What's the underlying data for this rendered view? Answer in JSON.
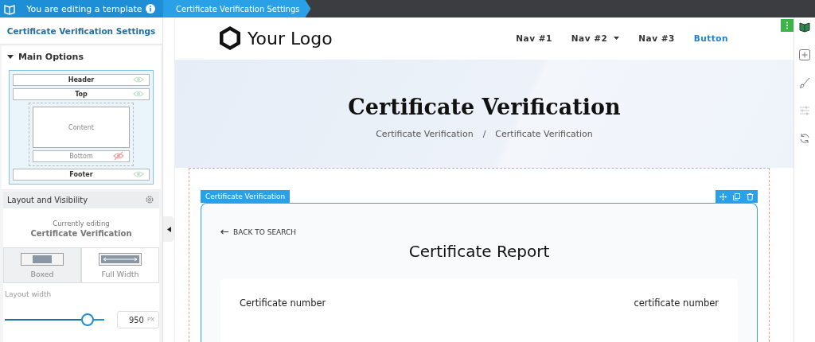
{
  "top_bar": {
    "notice": "You are editing a template",
    "breadcrumb": "Certificate Verification Settings"
  },
  "sidebar": {
    "title": "Certificate Verification Settings",
    "section": {
      "label": "Main Options",
      "expanded": true
    },
    "layout_diagram": [
      {
        "kind": "bar",
        "label": "Header",
        "visible": true
      },
      {
        "kind": "bar",
        "label": "Top",
        "visible": true
      },
      {
        "kind": "content",
        "label": "Content"
      },
      {
        "kind": "inner",
        "label": "Bottom",
        "visible": false
      },
      {
        "kind": "bar",
        "label": "Footer",
        "visible": true
      }
    ],
    "layout_visibility": "Layout and Visibility",
    "currently_editing": {
      "caption": "Currently editing",
      "name": "Certificate Verification"
    },
    "layout_options": [
      {
        "kind": "boxed",
        "label": "Boxed",
        "selected": true
      },
      {
        "kind": "full",
        "label": "Full Width",
        "selected": false
      }
    ],
    "layout_width": {
      "label": "Layout width",
      "level": 0.82,
      "value": "950",
      "unit": "PX"
    }
  },
  "page": {
    "logo": "Your Logo",
    "nav": [
      {
        "label": "Nav #1",
        "kind": "link",
        "dropdown": false
      },
      {
        "label": "Nav #2",
        "kind": "link",
        "dropdown": true
      },
      {
        "label": "Nav #3",
        "kind": "link",
        "dropdown": false
      },
      {
        "label": "Button",
        "kind": "button",
        "dropdown": false
      }
    ],
    "hero": {
      "title": "Certificate Verification",
      "breadcrumb": [
        "Certificate Verification",
        "Certificate Verification"
      ],
      "breadcrumb_separator": "/"
    },
    "widget": {
      "tag": "Certificate Verification",
      "back_link": "BACK TO SEARCH",
      "title": "Certificate Report",
      "rows": [
        {
          "label": "Certificate number",
          "value": "certificate number"
        }
      ]
    }
  }
}
